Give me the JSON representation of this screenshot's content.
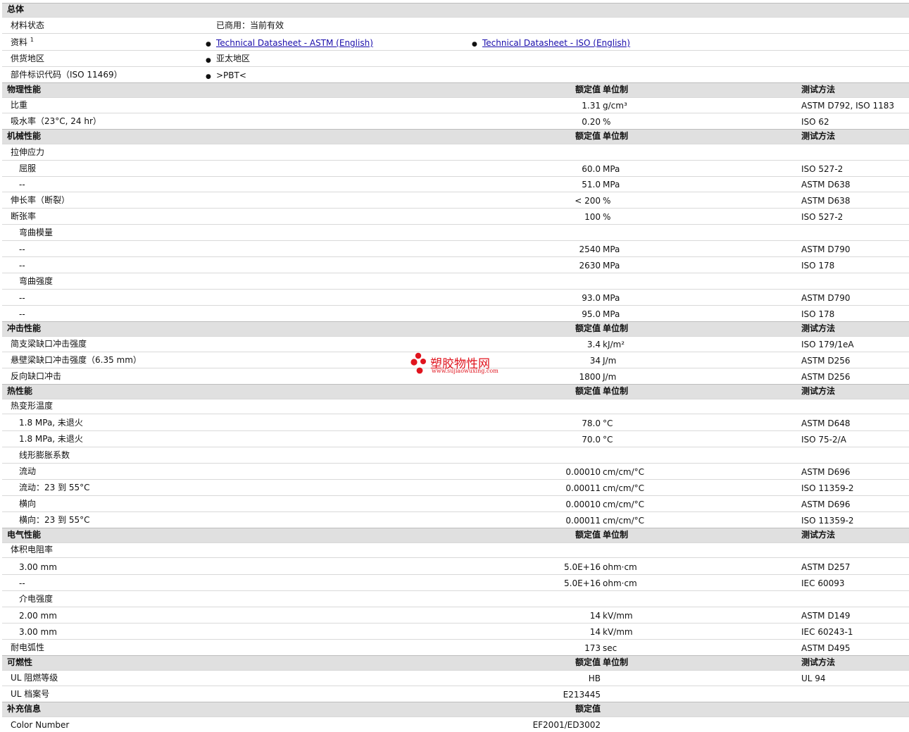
{
  "general": {
    "heading": "总体",
    "status_label": "材料状态",
    "status_value": "已商用：当前有效",
    "docs_label": "资料",
    "docs_sup": "1",
    "doc1": "Technical Datasheet - ASTM (English)",
    "doc2": "Technical Datasheet - ISO (English)",
    "supply_label": "供货地区",
    "supply_value": "亚太地区",
    "marking_label": "部件标识代码（ISO 11469）",
    "marking_value": ">PBT<",
    "bullet": "●"
  },
  "col_headers": {
    "value": "额定值",
    "unit": "单位制",
    "method": "测试方法"
  },
  "sections": [
    {
      "title": "物理性能",
      "rows": [
        {
          "label": "比重",
          "value": "1.31",
          "unit": "g/cm³",
          "method": "ASTM D792, ISO 1183"
        },
        {
          "label": "吸水率（23°C, 24 hr）",
          "value": "0.20",
          "unit": "%",
          "method": "ISO 62"
        }
      ]
    },
    {
      "title": "机械性能",
      "rows": [
        {
          "label": "拉伸应力"
        },
        {
          "label": "屈服",
          "value": "60.0",
          "unit": "MPa",
          "method": "ISO 527-2"
        },
        {
          "label": "--",
          "value": "51.0",
          "unit": "MPa",
          "method": "ASTM D638"
        },
        {
          "label": "伸长率（断裂）",
          "value": "< 200",
          "unit": "%",
          "method": "ASTM D638"
        },
        {
          "label": "断张率",
          "value": "100",
          "unit": "%",
          "method": "ISO 527-2"
        },
        {
          "label": "弯曲模量"
        },
        {
          "label": "--",
          "value": "2540",
          "unit": "MPa",
          "method": "ASTM D790"
        },
        {
          "label": "--",
          "value": "2630",
          "unit": "MPa",
          "method": "ISO 178"
        },
        {
          "label": "弯曲强度"
        },
        {
          "label": "--",
          "value": "93.0",
          "unit": "MPa",
          "method": "ASTM D790"
        },
        {
          "label": "--",
          "value": "95.0",
          "unit": "MPa",
          "method": "ISO 178"
        }
      ]
    },
    {
      "title": "冲击性能",
      "rows": [
        {
          "label": "简支梁缺口冲击强度",
          "value": "3.4",
          "unit": "kJ/m²",
          "method": "ISO 179/1eA"
        },
        {
          "label": "悬壁梁缺口冲击强度（6.35 mm）",
          "value": "34",
          "unit": "J/m",
          "method": "ASTM D256"
        },
        {
          "label": "反向缺口冲击",
          "value": "1800",
          "unit": "J/m",
          "method": "ASTM D256"
        }
      ]
    },
    {
      "title": "热性能",
      "rows": [
        {
          "label": "热变形温度"
        },
        {
          "label": "1.8 MPa, 未退火",
          "value": "78.0",
          "unit": "°C",
          "method": "ASTM D648"
        },
        {
          "label": "1.8 MPa, 未退火",
          "value": "70.0",
          "unit": "°C",
          "method": "ISO 75-2/A"
        },
        {
          "label": "线形膨胀系数"
        },
        {
          "label": "流动",
          "value": "0.00010",
          "unit": "cm/cm/°C",
          "method": "ASTM D696"
        },
        {
          "label": "流动：23 到 55°C",
          "value": "0.00011",
          "unit": "cm/cm/°C",
          "method": "ISO 11359-2"
        },
        {
          "label": "横向",
          "value": "0.00010",
          "unit": "cm/cm/°C",
          "method": "ASTM D696"
        },
        {
          "label": "横向：23 到 55°C",
          "value": "0.00011",
          "unit": "cm/cm/°C",
          "method": "ISO 11359-2"
        }
      ]
    },
    {
      "title": "电气性能",
      "rows": [
        {
          "label": "体积电阻率"
        },
        {
          "label": "3.00 mm",
          "value": "5.0E+16",
          "unit": "ohm·cm",
          "method": "ASTM D257"
        },
        {
          "label": "--",
          "value": "5.0E+16",
          "unit": "ohm·cm",
          "method": "IEC 60093"
        },
        {
          "label": "介电强度"
        },
        {
          "label": "2.00 mm",
          "value": "14",
          "unit": "kV/mm",
          "method": "ASTM D149"
        },
        {
          "label": "3.00 mm",
          "value": "14",
          "unit": "kV/mm",
          "method": "IEC 60243-1"
        },
        {
          "label": "耐电弧性",
          "value": "173",
          "unit": "sec",
          "method": "ASTM D495"
        }
      ]
    },
    {
      "title": "可燃性",
      "rows": [
        {
          "label": "UL 阻燃等级",
          "value": "HB",
          "unit": "",
          "method": "UL 94"
        },
        {
          "label": "UL 档案号",
          "value": "E213445",
          "unit": "",
          "method": ""
        }
      ]
    },
    {
      "title": "补充信息",
      "value_only": true,
      "rows": [
        {
          "label": "Color Number",
          "value": "EF2001/ED3002",
          "unit": "",
          "method": ""
        }
      ]
    }
  ],
  "watermark": {
    "title": "塑胶物性网",
    "url": "www.sujiaowuxing.com",
    "color": "#e0141e"
  }
}
